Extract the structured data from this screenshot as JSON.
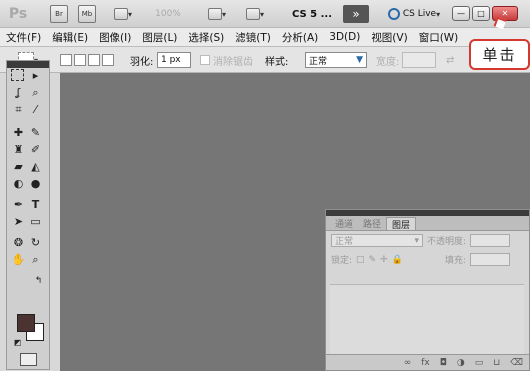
{
  "titlebar": {
    "app_logo": "Ps",
    "bridge_label": "Br",
    "minibridge_label": "Mb",
    "zoom_label": "100%",
    "workspace_label": "CS 5 ...",
    "more_label": "»",
    "cslive_label": "CS Live",
    "window_buttons": [
      "—",
      "□",
      "✕"
    ]
  },
  "menubar": {
    "items": [
      "文件(F)",
      "编辑(E)",
      "图像(I)",
      "图层(L)",
      "选择(S)",
      "滤镜(T)",
      "分析(A)",
      "3D(D)",
      "视图(V)",
      "窗口(W)"
    ]
  },
  "options": {
    "feather_label": "羽化:",
    "feather_value": "1 px",
    "antialias_label": "消除锯齿",
    "style_label": "样式:",
    "style_value": "正常",
    "width_label": "宽度:"
  },
  "layers_panel": {
    "tabs": [
      "通道",
      "路径",
      "图层"
    ],
    "blend_mode": "正常",
    "opacity_label": "不透明度:",
    "lock_label": "锁定:",
    "fill_label": "填充:",
    "footer_icons": [
      "link-icon",
      "fx-icon",
      "mask-icon",
      "adjustment-icon",
      "group-icon",
      "new-layer-icon",
      "trash-icon"
    ]
  },
  "callout": {
    "text": "单击"
  },
  "colors": {
    "foreground": "#4a3330",
    "background": "#ffffff",
    "canvas": "#767677",
    "callout_border": "#d5382f"
  }
}
